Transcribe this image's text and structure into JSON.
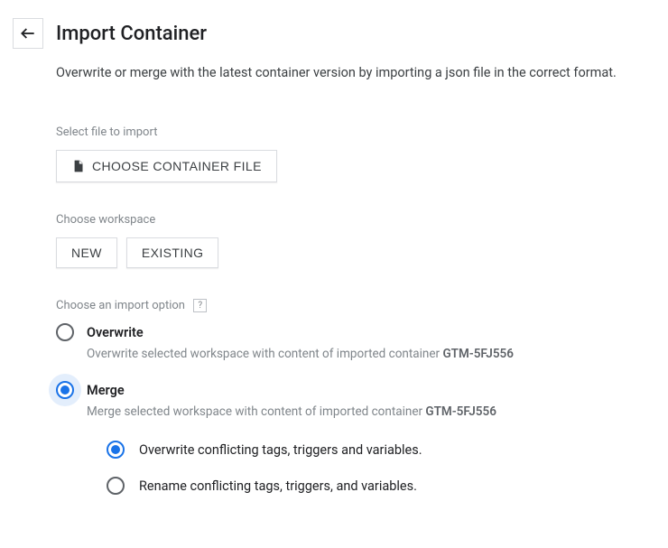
{
  "header": {
    "title": "Import Container"
  },
  "intro": "Overwrite or merge with the latest container version by importing a json file in the correct format.",
  "file_section": {
    "label": "Select file to import",
    "button": "CHOOSE CONTAINER FILE"
  },
  "workspace_section": {
    "label": "Choose workspace",
    "new_button": "NEW",
    "existing_button": "EXISTING"
  },
  "import_option": {
    "label": "Choose an import option",
    "help": "?",
    "container_id": "GTM-5FJ556",
    "overwrite": {
      "title": "Overwrite",
      "desc_prefix": "Overwrite selected workspace with content of imported container "
    },
    "merge": {
      "title": "Merge",
      "desc_prefix": "Merge selected workspace with content of imported container ",
      "sub_overwrite": "Overwrite conflicting tags, triggers and variables.",
      "sub_rename": "Rename conflicting tags, triggers, and variables."
    }
  }
}
